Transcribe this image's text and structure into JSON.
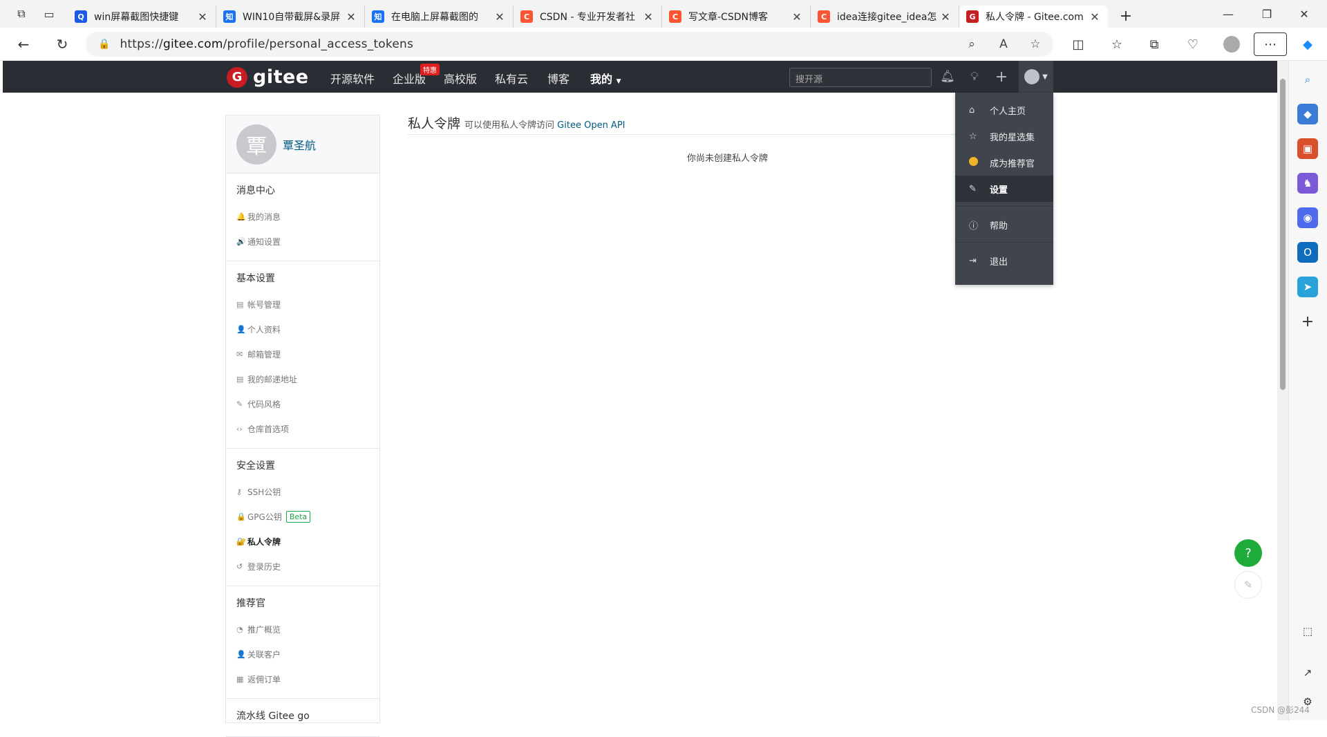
{
  "browser": {
    "tabs": [
      {
        "title": "win屏幕截图快捷键",
        "fav_text": "Q",
        "fav_color": "#1a5ae6"
      },
      {
        "title": "WIN10自带截屏&录屏",
        "fav_text": "知",
        "fav_color": "#1772f6"
      },
      {
        "title": "在电脑上屏幕截图的",
        "fav_text": "知",
        "fav_color": "#1772f6"
      },
      {
        "title": "CSDN - 专业开发者社",
        "fav_text": "C",
        "fav_color": "#fc5531"
      },
      {
        "title": "写文章-CSDN博客",
        "fav_text": "C",
        "fav_color": "#fc5531"
      },
      {
        "title": "idea连接gitee_idea怎",
        "fav_text": "C",
        "fav_color": "#fc5531"
      },
      {
        "title": "私人令牌 - Gitee.com",
        "fav_text": "G",
        "fav_color": "#c71d23"
      }
    ],
    "url_prefix": "https://",
    "url_host": "gitee.com",
    "url_path": "/profile/personal_access_tokens"
  },
  "gitee": {
    "logo_text": "gitee",
    "nav": [
      "开源软件",
      "企业版",
      "高校版",
      "私有云",
      "博客",
      "我的"
    ],
    "hot_badge": "特惠",
    "search_placeholder": "搜开源"
  },
  "profile": {
    "avatar_char": "覃",
    "name": "覃圣航"
  },
  "sidebar": {
    "sections": [
      {
        "title": "消息中心",
        "items": [
          {
            "label": "我的消息",
            "icon": "bell-icon",
            "glyph": "🔔"
          },
          {
            "label": "通知设置",
            "icon": "volume-icon",
            "glyph": "🔊"
          }
        ]
      },
      {
        "title": "基本设置",
        "items": [
          {
            "label": "帐号管理",
            "icon": "id-card-icon",
            "glyph": "▤"
          },
          {
            "label": "个人资料",
            "icon": "user-icon",
            "glyph": "👤"
          },
          {
            "label": "邮箱管理",
            "icon": "mail-icon",
            "glyph": "✉"
          },
          {
            "label": "我的邮递地址",
            "icon": "address-card-icon",
            "glyph": "▤"
          },
          {
            "label": "代码风格",
            "icon": "brush-icon",
            "glyph": "✎"
          },
          {
            "label": "仓库首选项",
            "icon": "code-icon",
            "glyph": "‹›"
          }
        ]
      },
      {
        "title": "安全设置",
        "items": [
          {
            "label": "SSH公钥",
            "icon": "key-icon",
            "glyph": "⚷"
          },
          {
            "label": "GPG公钥",
            "icon": "lock-icon",
            "glyph": "🔒",
            "badge": "Beta"
          },
          {
            "label": "私人令牌",
            "icon": "token-icon",
            "glyph": "🔐",
            "active": true
          },
          {
            "label": "登录历史",
            "icon": "history-icon",
            "glyph": "↺"
          }
        ]
      },
      {
        "title": "推荐官",
        "items": [
          {
            "label": "推广概览",
            "icon": "chart-icon",
            "glyph": "◔"
          },
          {
            "label": "关联客户",
            "icon": "users-icon",
            "glyph": "👤"
          },
          {
            "label": "返佣订单",
            "icon": "order-icon",
            "glyph": "▦"
          }
        ]
      },
      {
        "title": "流水线 Gitee go",
        "items": []
      }
    ]
  },
  "main": {
    "title": "私人令牌",
    "subtitle": "可以使用私人令牌访问",
    "subtitle_link": "Gitee Open API",
    "empty_text": "你尚未创建私人令牌"
  },
  "dropdown": {
    "items": [
      {
        "label": "个人主页",
        "icon": "home-icon"
      },
      {
        "label": "我的星选集",
        "icon": "star-icon"
      },
      {
        "label": "成为推荐官",
        "icon": "coin-icon"
      },
      {
        "label": "设置",
        "icon": "edit-icon",
        "active": true
      },
      {
        "label": "帮助",
        "icon": "help-circle-icon"
      },
      {
        "label": "退出",
        "icon": "logout-icon"
      }
    ]
  },
  "floating": {
    "help_glyph": "?",
    "watermark": "CSDN @彭244"
  },
  "colors": {
    "gitee_red": "#c71d23",
    "header_bg": "#2a2d33",
    "link_blue": "#005980",
    "accent_orange": "#fe7300",
    "help_green": "#1fab39"
  }
}
